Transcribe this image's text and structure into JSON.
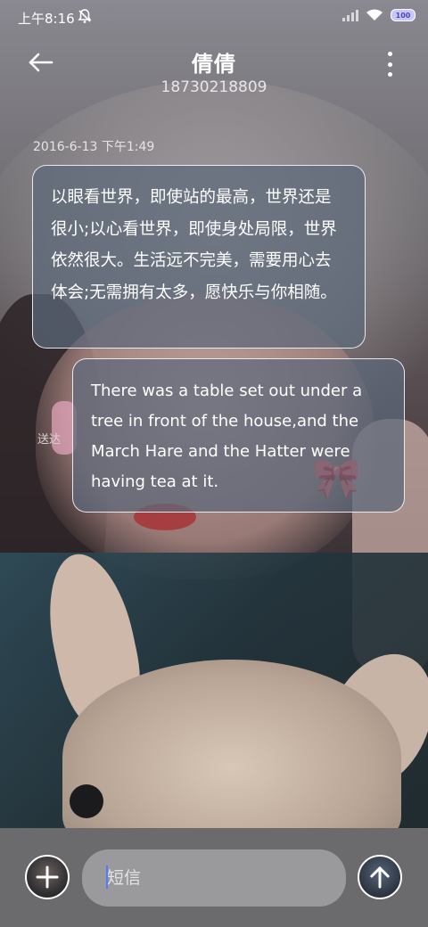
{
  "status_bar": {
    "time": "上午8:16",
    "dnd_icon": "dnd-icon",
    "signal_icon": "signal-icon",
    "wifi_icon": "wifi-icon",
    "battery_label": "100"
  },
  "header": {
    "back_icon": "back-arrow-icon",
    "contact_name": "倩倩",
    "contact_number": "18730218809",
    "more_icon": "more-vertical-icon"
  },
  "conversation": {
    "timestamp": "2016-6-13 下午1:49",
    "messages": [
      {
        "direction": "incoming",
        "text": "以眼看世界，即使站的最高，世界还是很小;以心看世界，即使身处局限，世界依然很大。生活远不完美，需要用心去体会;无需拥有太多，愿快乐与你相随。"
      },
      {
        "direction": "outgoing",
        "text": "There was a table set out under a tree in front of the house,and the March Hare and the Hatter were having tea at it.",
        "status": "送达"
      }
    ]
  },
  "compose": {
    "placeholder": "短信",
    "attach_icon": "plus-icon",
    "send_icon": "arrow-up-icon"
  },
  "colors": {
    "bubble_fill": "#5c687a",
    "bubble_border": "#ffffff",
    "compose_bar": "#6b6b6d",
    "input_fill": "#9a9a9c",
    "caret": "#4d7dff"
  }
}
